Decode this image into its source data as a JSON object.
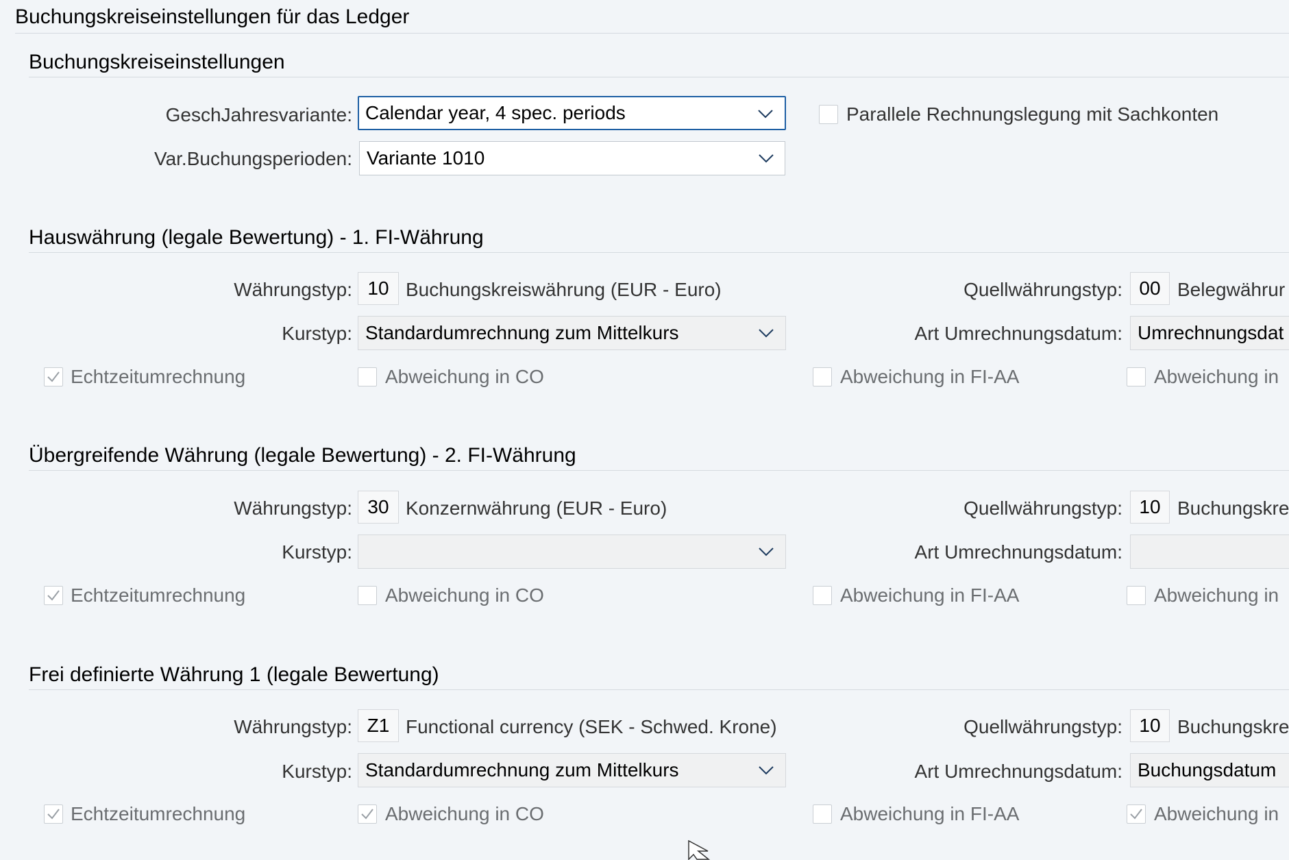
{
  "page": {
    "title": "Buchungskreiseinstellungen für das Ledger"
  },
  "settings": {
    "title": "Buchungskreiseinstellungen",
    "fiscal_year_label": "GeschJahresvariante:",
    "fiscal_year_value": "Calendar year, 4 spec. periods",
    "parallel_label": "Parallele Rechnungslegung mit Sachkonten",
    "parallel_checked": false,
    "posting_period_label": "Var.Buchungsperioden:",
    "posting_period_value": "Variante 1010"
  },
  "sections": [
    {
      "title": "Hauswährung (legale Bewertung) - 1. FI-Währung",
      "currency_type_label": "Währungstyp:",
      "currency_type_code": "10",
      "currency_type_desc": "Buchungskreiswährung (EUR - Euro)",
      "source_type_label": "Quellwährungstyp:",
      "source_type_code": "00",
      "source_type_desc": "Belegwährur",
      "rate_type_label": "Kurstyp:",
      "rate_type_value": "Standardumrechnung zum Mittelkurs",
      "conv_date_label": "Art Umrechnungsdatum:",
      "conv_date_value": "Umrechnungsdat",
      "realtime_label": "Echtzeitumrechnung",
      "realtime_checked": true,
      "dev_co_label": "Abweichung in CO",
      "dev_co_checked": false,
      "dev_fiaa_label": "Abweichung in FI-AA",
      "dev_fiaa_checked": false,
      "dev_other_label": "Abweichung in",
      "dev_other_checked": false
    },
    {
      "title": "Übergreifende Währung (legale Bewertung) - 2. FI-Währung",
      "currency_type_label": "Währungstyp:",
      "currency_type_code": "30",
      "currency_type_desc": "Konzernwährung (EUR - Euro)",
      "source_type_label": "Quellwährungstyp:",
      "source_type_code": "10",
      "source_type_desc": "Buchungskre",
      "rate_type_label": "Kurstyp:",
      "rate_type_value": "",
      "conv_date_label": "Art Umrechnungsdatum:",
      "conv_date_value": "",
      "realtime_label": "Echtzeitumrechnung",
      "realtime_checked": true,
      "dev_co_label": "Abweichung in CO",
      "dev_co_checked": false,
      "dev_fiaa_label": "Abweichung in FI-AA",
      "dev_fiaa_checked": false,
      "dev_other_label": "Abweichung in",
      "dev_other_checked": false
    },
    {
      "title": "Frei definierte Währung 1 (legale Bewertung)",
      "currency_type_label": "Währungstyp:",
      "currency_type_code": "Z1",
      "currency_type_desc": "Functional currency (SEK - Schwed. Krone)",
      "source_type_label": "Quellwährungstyp:",
      "source_type_code": "10",
      "source_type_desc": "Buchungskre",
      "rate_type_label": "Kurstyp:",
      "rate_type_value": "Standardumrechnung zum Mittelkurs",
      "conv_date_label": "Art Umrechnungsdatum:",
      "conv_date_value": "Buchungsdatum",
      "realtime_label": "Echtzeitumrechnung",
      "realtime_checked": true,
      "dev_co_label": "Abweichung in CO",
      "dev_co_checked": true,
      "dev_fiaa_label": "Abweichung in FI-AA",
      "dev_fiaa_checked": false,
      "dev_other_label": "Abweichung in",
      "dev_other_checked": true
    }
  ],
  "colors": {
    "background": "#f2f5f8",
    "focus_border": "#1c5ea3",
    "divider": "#d5dadf",
    "disabled_text": "#6a6d70"
  }
}
